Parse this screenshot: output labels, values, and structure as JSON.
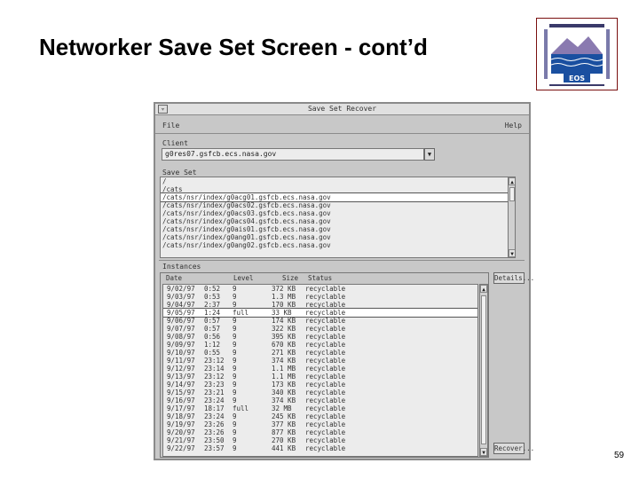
{
  "slide": {
    "title": "Networker Save Set Screen - cont’d",
    "page_number": "59",
    "logo_text": "EOS"
  },
  "window": {
    "title": "Save Set Recover",
    "sys_button": "▿",
    "menu": {
      "file": "File",
      "help": "Help"
    },
    "client": {
      "label": "Client",
      "value": "g0res07.gsfcb.ecs.nasa.gov",
      "arrow": "▼"
    },
    "save_set": {
      "label": "Save Set",
      "items": [
        {
          "text": "/",
          "selected": false
        },
        {
          "text": "/cats",
          "selected": false
        },
        {
          "text": "/cats/nsr/index/g0acg01.gsfcb.ecs.nasa.gov",
          "selected": true
        },
        {
          "text": "/cats/nsr/index/g0acs02.gsfcb.ecs.nasa.gov",
          "selected": false
        },
        {
          "text": "/cats/nsr/index/g0acs03.gsfcb.ecs.nasa.gov",
          "selected": false
        },
        {
          "text": "/cats/nsr/index/g0acs04.gsfcb.ecs.nasa.gov",
          "selected": false
        },
        {
          "text": "/cats/nsr/index/g0ais01.gsfcb.ecs.nasa.gov",
          "selected": false
        },
        {
          "text": "/cats/nsr/index/g0ang01.gsfcb.ecs.nasa.gov",
          "selected": false
        },
        {
          "text": "/cats/nsr/index/g0ang02.gsfcb.ecs.nasa.gov",
          "selected": false
        }
      ]
    },
    "instances": {
      "label": "Instances",
      "headers": {
        "date": "Date",
        "level": "Level",
        "size": "Size",
        "status": "Status"
      },
      "rows": [
        {
          "date": "9/02/97",
          "time": "0:52",
          "level": "9",
          "size": "372 KB",
          "status": "recyclable",
          "selected": false
        },
        {
          "date": "9/03/97",
          "time": "0:53",
          "level": "9",
          "size": "1.3 MB",
          "status": "recyclable",
          "selected": false
        },
        {
          "date": "9/04/97",
          "time": "2:37",
          "level": "9",
          "size": "170 KB",
          "status": "recyclable",
          "selected": false
        },
        {
          "date": "9/05/97",
          "time": "1:24",
          "level": "full",
          "size": "33 KB",
          "status": "recyclable",
          "selected": true
        },
        {
          "date": "9/06/97",
          "time": "0:57",
          "level": "9",
          "size": "174 KB",
          "status": "recyclable",
          "selected": false
        },
        {
          "date": "9/07/97",
          "time": "0:57",
          "level": "9",
          "size": "322 KB",
          "status": "recyclable",
          "selected": false
        },
        {
          "date": "9/08/97",
          "time": "0:56",
          "level": "9",
          "size": "395 KB",
          "status": "recyclable",
          "selected": false
        },
        {
          "date": "9/09/97",
          "time": "1:12",
          "level": "9",
          "size": "670 KB",
          "status": "recyclable",
          "selected": false
        },
        {
          "date": "9/10/97",
          "time": "0:55",
          "level": "9",
          "size": "271 KB",
          "status": "recyclable",
          "selected": false
        },
        {
          "date": "9/11/97",
          "time": "23:12",
          "level": "9",
          "size": "374 KB",
          "status": "recyclable",
          "selected": false
        },
        {
          "date": "9/12/97",
          "time": "23:14",
          "level": "9",
          "size": "1.1 MB",
          "status": "recyclable",
          "selected": false
        },
        {
          "date": "9/13/97",
          "time": "23:12",
          "level": "9",
          "size": "1.1 MB",
          "status": "recyclable",
          "selected": false
        },
        {
          "date": "9/14/97",
          "time": "23:23",
          "level": "9",
          "size": "173 KB",
          "status": "recyclable",
          "selected": false
        },
        {
          "date": "9/15/97",
          "time": "23:21",
          "level": "9",
          "size": "340 KB",
          "status": "recyclable",
          "selected": false
        },
        {
          "date": "9/16/97",
          "time": "23:24",
          "level": "9",
          "size": "374 KB",
          "status": "recyclable",
          "selected": false
        },
        {
          "date": "9/17/97",
          "time": "18:17",
          "level": "full",
          "size": "32 MB",
          "status": "recyclable",
          "selected": false
        },
        {
          "date": "9/18/97",
          "time": "23:24",
          "level": "9",
          "size": "245 KB",
          "status": "recyclable",
          "selected": false
        },
        {
          "date": "9/19/97",
          "time": "23:26",
          "level": "9",
          "size": "377 KB",
          "status": "recyclable",
          "selected": false
        },
        {
          "date": "9/20/97",
          "time": "23:26",
          "level": "9",
          "size": "877 KB",
          "status": "recyclable",
          "selected": false
        },
        {
          "date": "9/21/97",
          "time": "23:50",
          "level": "9",
          "size": "270 KB",
          "status": "recyclable",
          "selected": false
        },
        {
          "date": "9/22/97",
          "time": "23:57",
          "level": "9",
          "size": "441 KB",
          "status": "recyclable",
          "selected": false
        }
      ]
    },
    "buttons": {
      "details": "Details...",
      "recover": "Recover..."
    },
    "scroll_arrows": {
      "up": "▲",
      "down": "▼"
    }
  },
  "colors": {
    "window_bg": "#c8c8c8",
    "list_bg": "#ececec",
    "logo_border": "#7a1010",
    "logo_water": "#1a4fa0"
  }
}
